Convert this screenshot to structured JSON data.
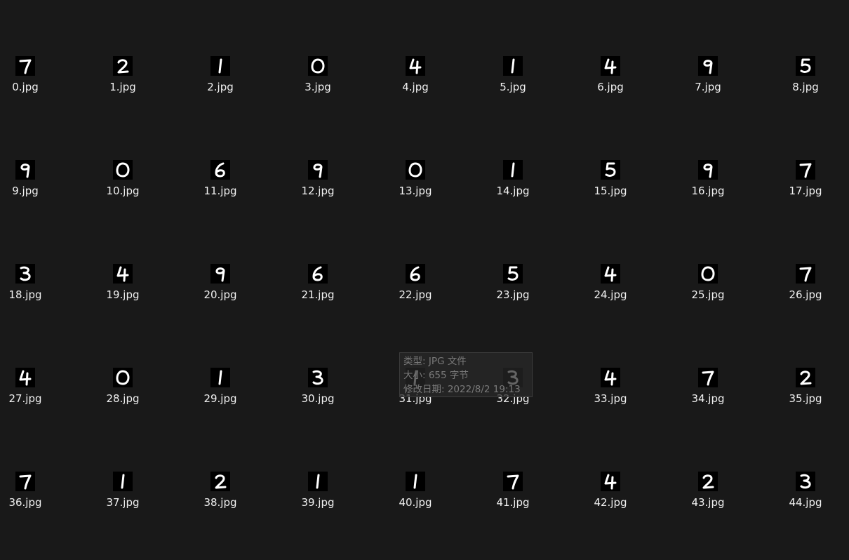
{
  "files": [
    {
      "name": "0.jpg",
      "digit": "7"
    },
    {
      "name": "1.jpg",
      "digit": "2"
    },
    {
      "name": "2.jpg",
      "digit": "1"
    },
    {
      "name": "3.jpg",
      "digit": "0"
    },
    {
      "name": "4.jpg",
      "digit": "4"
    },
    {
      "name": "5.jpg",
      "digit": "1"
    },
    {
      "name": "6.jpg",
      "digit": "4"
    },
    {
      "name": "7.jpg",
      "digit": "9"
    },
    {
      "name": "8.jpg",
      "digit": "5"
    },
    {
      "name": "9.jpg",
      "digit": "9"
    },
    {
      "name": "10.jpg",
      "digit": "0"
    },
    {
      "name": "11.jpg",
      "digit": "6"
    },
    {
      "name": "12.jpg",
      "digit": "9"
    },
    {
      "name": "13.jpg",
      "digit": "0"
    },
    {
      "name": "14.jpg",
      "digit": "1"
    },
    {
      "name": "15.jpg",
      "digit": "5"
    },
    {
      "name": "16.jpg",
      "digit": "9"
    },
    {
      "name": "17.jpg",
      "digit": "7"
    },
    {
      "name": "18.jpg",
      "digit": "3"
    },
    {
      "name": "19.jpg",
      "digit": "4"
    },
    {
      "name": "20.jpg",
      "digit": "9"
    },
    {
      "name": "21.jpg",
      "digit": "6"
    },
    {
      "name": "22.jpg",
      "digit": "6"
    },
    {
      "name": "23.jpg",
      "digit": "5"
    },
    {
      "name": "24.jpg",
      "digit": "4"
    },
    {
      "name": "25.jpg",
      "digit": "0"
    },
    {
      "name": "26.jpg",
      "digit": "7"
    },
    {
      "name": "27.jpg",
      "digit": "4"
    },
    {
      "name": "28.jpg",
      "digit": "0"
    },
    {
      "name": "29.jpg",
      "digit": "1"
    },
    {
      "name": "30.jpg",
      "digit": "3"
    },
    {
      "name": "31.jpg",
      "digit": "1"
    },
    {
      "name": "32.jpg",
      "digit": "3"
    },
    {
      "name": "33.jpg",
      "digit": "4"
    },
    {
      "name": "34.jpg",
      "digit": "7"
    },
    {
      "name": "35.jpg",
      "digit": "2"
    },
    {
      "name": "36.jpg",
      "digit": "7"
    },
    {
      "name": "37.jpg",
      "digit": "1"
    },
    {
      "name": "38.jpg",
      "digit": "2"
    },
    {
      "name": "39.jpg",
      "digit": "1"
    },
    {
      "name": "40.jpg",
      "digit": "1"
    },
    {
      "name": "41.jpg",
      "digit": "7"
    },
    {
      "name": "42.jpg",
      "digit": "4"
    },
    {
      "name": "43.jpg",
      "digit": "2"
    },
    {
      "name": "44.jpg",
      "digit": "3"
    }
  ],
  "tooltip": {
    "type_line": "类型: JPG 文件",
    "size_line": "大小: 655 字节",
    "date_line": "修改日期: 2022/8/2 19:13"
  },
  "colors": {
    "background": "#191919",
    "text": "#f0f0f0",
    "thumbnail_ink": "#ffffff",
    "tooltip_text": "#7a7a7a"
  }
}
